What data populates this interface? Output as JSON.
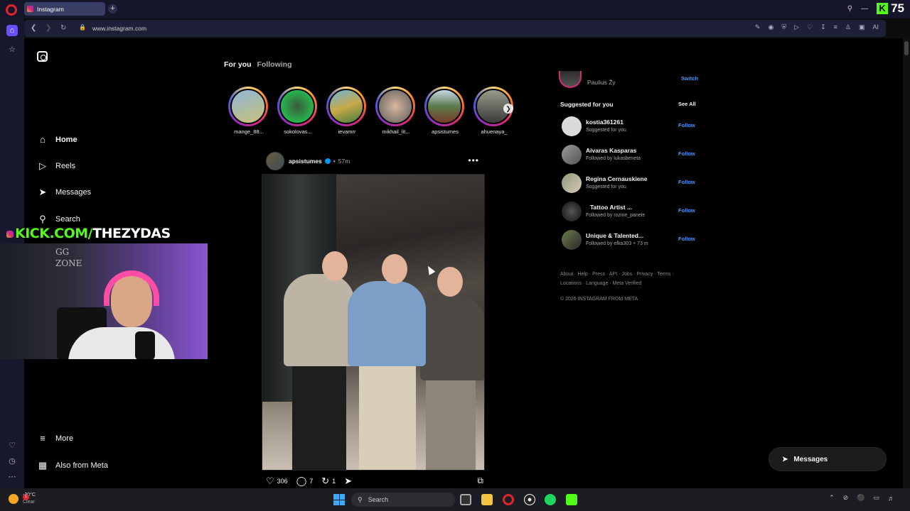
{
  "browser": {
    "tab_title": "Instagram",
    "url": "www.instagram.com",
    "kick_count": "75",
    "ai_label": "AI"
  },
  "sidebar": {
    "items": [
      {
        "label": "Home",
        "icon": "home-icon"
      },
      {
        "label": "Reels",
        "icon": "reels-icon"
      },
      {
        "label": "Messages",
        "icon": "messages-icon"
      },
      {
        "label": "Search",
        "icon": "search-icon"
      }
    ],
    "more_label": "More",
    "also_meta_label": "Also from Meta"
  },
  "feed": {
    "tabs": [
      "For you",
      "Following"
    ],
    "stories": [
      "mange_88...",
      "sokolovas...",
      "ievamrr",
      "mikhail_lit...",
      "apsistumes",
      "ahuenaya_"
    ],
    "post": {
      "username": "apsistumes",
      "time": "57m",
      "likes": "306",
      "comments": "7",
      "reposts": "1"
    }
  },
  "right": {
    "me_name": "Paulius Žy",
    "switch_label": "Switch",
    "suggested_heading": "Suggested for you",
    "see_all_label": "See All",
    "follow_label": "Follow",
    "suggestions": [
      {
        "name": "kostia361261",
        "sub": "Suggested for you"
      },
      {
        "name": "Aivaras Kasparas",
        "sub": "Followed by lukasbeneta"
      },
      {
        "name": "Regina Cernauskiene",
        "sub": "Suggested for you"
      },
      {
        "name": "Tattoo Artist ...",
        "sub": "Followed by rozine_panele"
      },
      {
        "name": "Unique & Talented...",
        "sub": "Followed by efka303 + 73 m"
      }
    ],
    "footer_line1": "About · Help · Press · API · Jobs · Privacy · Terms ·",
    "footer_line2": "Locations · Language · Meta Verified",
    "copyright": "© 2026 INSTAGRAM FROM META"
  },
  "messages_button": "Messages",
  "overlay": {
    "kick_domain": "KICK.COM/",
    "kick_channel": "THEZYDAS",
    "wall_art": "GG\nZONE"
  },
  "taskbar": {
    "temperature": "-20°C",
    "weather": "Clear",
    "weather_badge": "1",
    "search_placeholder": "Search"
  }
}
